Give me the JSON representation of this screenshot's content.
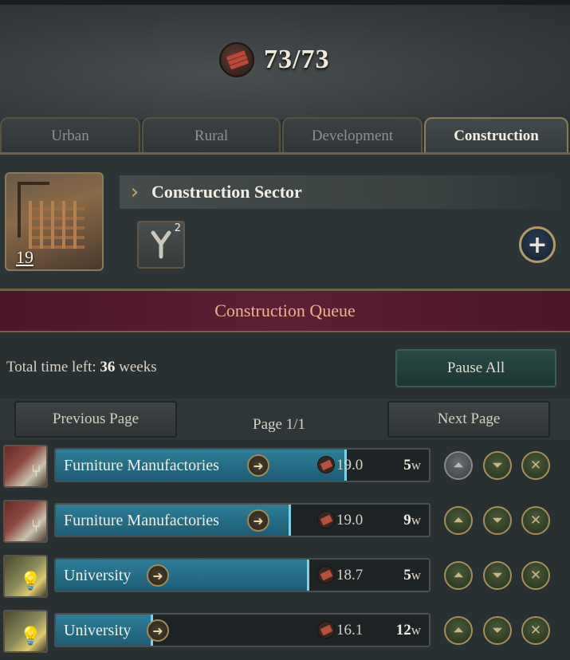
{
  "header": {
    "resource_value": "73/73",
    "resource_icon": "brick-icon"
  },
  "tabs": [
    {
      "label": "Urban",
      "active": false
    },
    {
      "label": "Rural",
      "active": false
    },
    {
      "label": "Development",
      "active": false
    },
    {
      "label": "Construction",
      "active": true
    }
  ],
  "sector": {
    "title": "Construction Sector",
    "level": "19",
    "method_count": "2"
  },
  "queue": {
    "title": "Construction Queue",
    "total_time_label": "Total time left:",
    "total_time_value": "36",
    "total_time_unit": "weeks",
    "pause_label": "Pause All",
    "prev_label": "Previous Page",
    "next_label": "Next Page",
    "page_label": "Page 1/1",
    "items": [
      {
        "name": "Furniture Manufactories",
        "cost": "19.0",
        "weeks": "5",
        "unit": "w",
        "progress": 0.78,
        "icon": "furniture-icon",
        "move_up_disabled": true
      },
      {
        "name": "Furniture Manufactories",
        "cost": "19.0",
        "weeks": "9",
        "unit": "w",
        "progress": 0.63,
        "icon": "furniture-icon",
        "move_up_disabled": false
      },
      {
        "name": "University",
        "cost": "18.7",
        "weeks": "5",
        "unit": "w",
        "progress": 0.68,
        "icon": "university-icon",
        "move_up_disabled": false
      },
      {
        "name": "University",
        "cost": "16.1",
        "weeks": "12",
        "unit": "w",
        "progress": 0.26,
        "icon": "university-icon",
        "move_up_disabled": false
      }
    ]
  }
}
